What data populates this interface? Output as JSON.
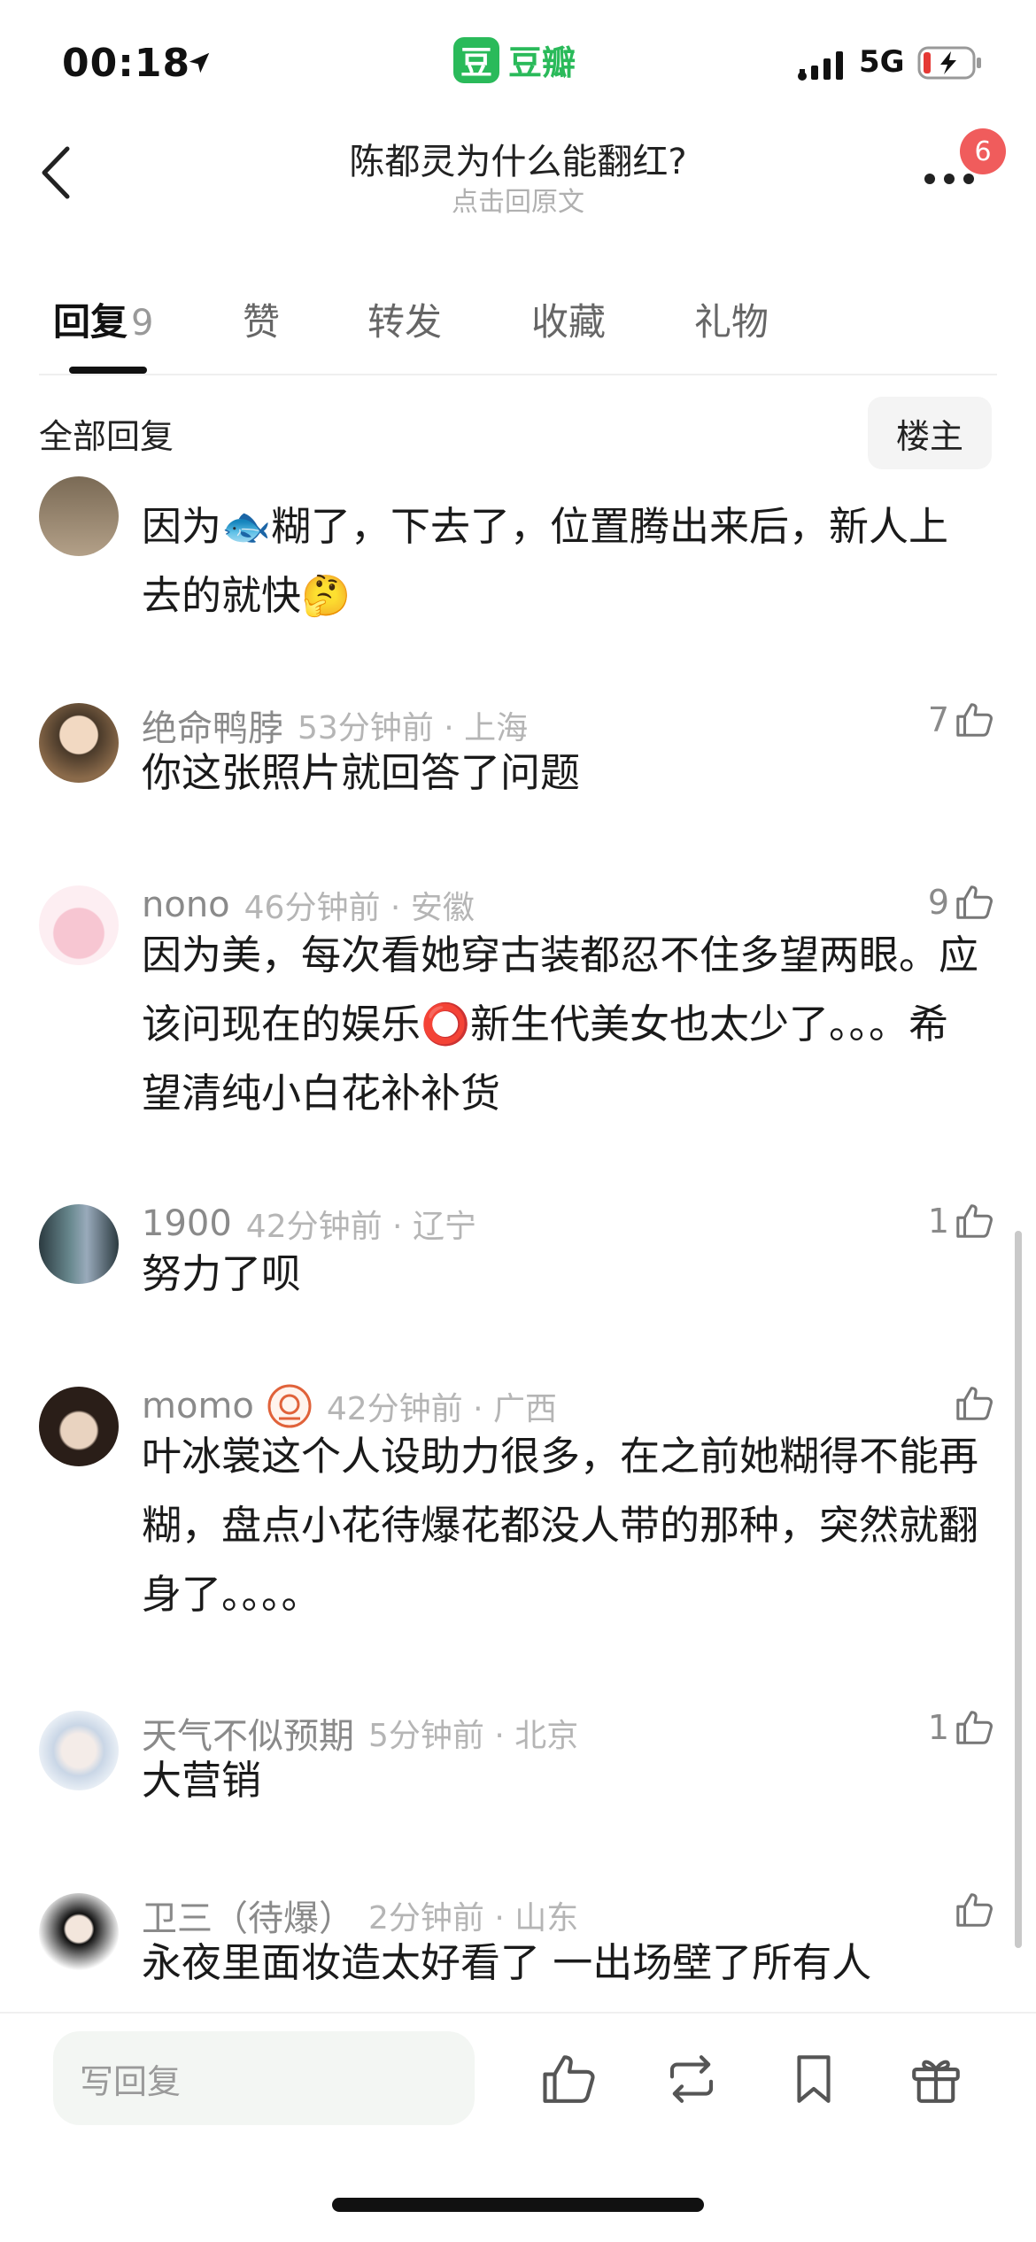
{
  "status_bar": {
    "time": "00:18",
    "network": "5G"
  },
  "app": {
    "logo_char": "豆",
    "name": "豆瓣"
  },
  "header": {
    "title": "陈都灵为什么能翻红?",
    "subtitle": "点击回原文",
    "badge_count": "6"
  },
  "tabs": [
    {
      "label": "回复",
      "count": "9",
      "active": true
    },
    {
      "label": "赞"
    },
    {
      "label": "转发"
    },
    {
      "label": "收藏"
    },
    {
      "label": "礼物"
    }
  ],
  "sort": {
    "all_replies": "全部回复",
    "op_only": "楼主"
  },
  "comments": [
    {
      "name": "",
      "time": "",
      "location": "",
      "likes": "",
      "text": "因为🐟糊了，下去了，位置腾出来后，新人上去的就快🤔"
    },
    {
      "name": "绝命鸭脖",
      "time": "53分钟前",
      "location": "上海",
      "likes": "7",
      "text": "你这张照片就回答了问题"
    },
    {
      "name": "nono",
      "time": "46分钟前",
      "location": "安徽",
      "likes": "9",
      "text": "因为美，每次看她穿古装都忍不住多望两眼。应该问现在的娱乐⭕新生代美女也太少了。。。希望清纯小白花补补货"
    },
    {
      "name": "1900",
      "time": "42分钟前",
      "location": "辽宁",
      "likes": "1",
      "text": "努力了呗"
    },
    {
      "name": "momo",
      "time": "42分钟前",
      "location": "广西",
      "likes": "",
      "text": "叶冰裳这个人设助力很多，在之前她糊得不能再糊，盘点小花待爆花都没人带的那种，突然就翻身了。。。。"
    },
    {
      "name": "天气不似预期",
      "time": "5分钟前",
      "location": "北京",
      "likes": "1",
      "text": "大营销"
    },
    {
      "name": "卫三（待爆）",
      "time": "2分钟前",
      "location": "山东",
      "likes": "",
      "text": "永夜里面妆造太好看了 一出场壁了所有人"
    }
  ],
  "bottom_bar": {
    "reply_placeholder": "写回复"
  },
  "colors": {
    "brand_green": "#2aba5a",
    "badge_red": "#f05c5c"
  }
}
